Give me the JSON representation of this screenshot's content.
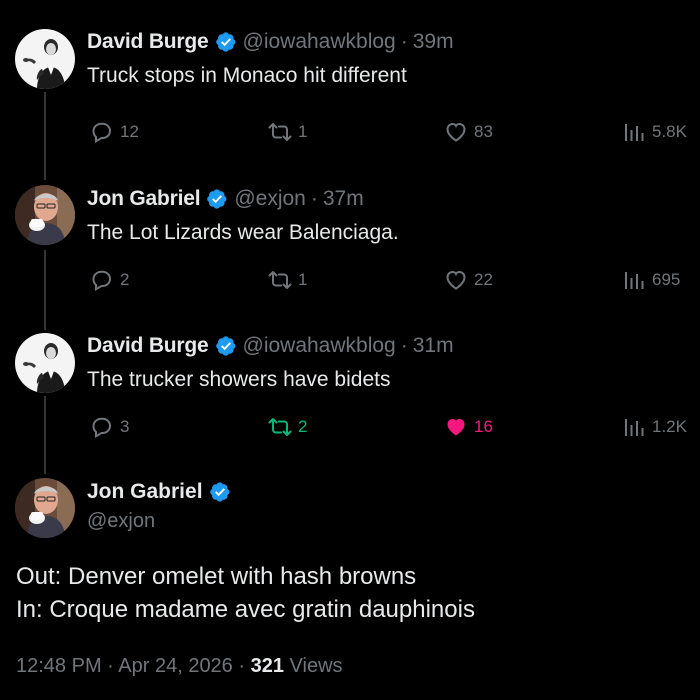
{
  "colors": {
    "background": "#000000",
    "text": "#e7e9ea",
    "muted": "#71767b",
    "verified": "#1d9bf0",
    "retweet_active": "#00ba7c",
    "like_active": "#f91880"
  },
  "tweets": [
    {
      "name": "David Burge",
      "handle": "@iowahawkblog",
      "time": "39m",
      "text": "Truck stops in Monaco hit different",
      "replies": "12",
      "retweets": "1",
      "likes": "83",
      "views": "5.8K"
    },
    {
      "name": "Jon Gabriel",
      "handle": "@exjon",
      "time": "37m",
      "text": "The Lot Lizards wear Balenciaga.",
      "replies": "2",
      "retweets": "1",
      "likes": "22",
      "views": "695"
    },
    {
      "name": "David Burge",
      "handle": "@iowahawkblog",
      "time": "31m",
      "text": "The trucker showers have bidets",
      "replies": "3",
      "retweets": "2",
      "likes": "16",
      "views": "1.2K"
    }
  ],
  "main_tweet": {
    "name": "Jon Gabriel",
    "handle": "@exjon",
    "line1": "Out: Denver omelet with hash browns",
    "line2": "In: Croque madame avec gratin dauphinois",
    "timestamp": "12:48 PM · Apr 24, 2026 · ",
    "views_count": "321",
    "views_label": " Views"
  },
  "separator": "·"
}
